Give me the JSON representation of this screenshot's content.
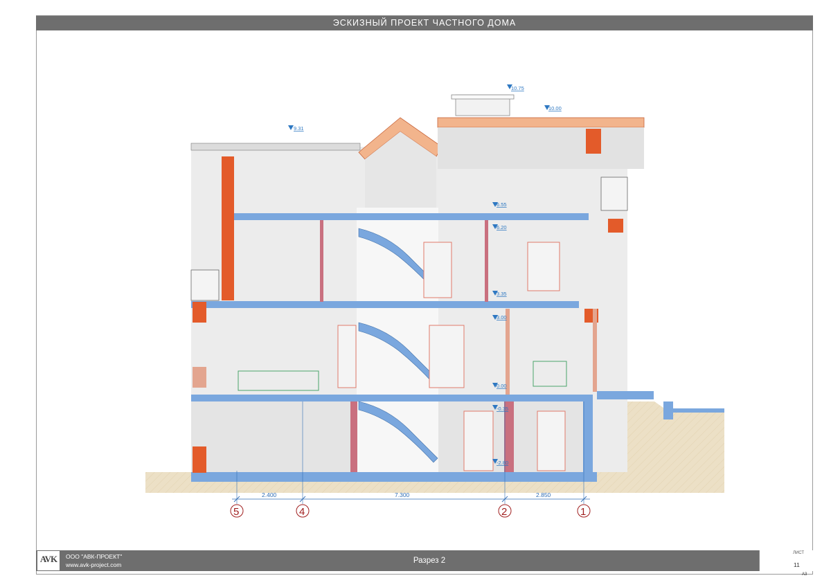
{
  "title": "ЭСКИЗНЫЙ ПРОЕКТ ЧАСТНОГО ДОМА",
  "elevations": [
    "10.75",
    "10.00",
    "9.31",
    "6.55",
    "6.20",
    "3.35",
    "3.00",
    "0.00",
    "-0.35",
    "-2.80"
  ],
  "dimensions": [
    "2.400",
    "7.300",
    "2.850"
  ],
  "axes": [
    "5",
    "4",
    "2",
    "1"
  ],
  "colors": {
    "slab": "#7aa7de",
    "brick": "#e35b2a",
    "soil": "#ece0c6",
    "title_bar": "#6e6e6e"
  },
  "footer": {
    "logo": "AVK",
    "company_name": "ООО \"АВК-ПРОЕКТ\"",
    "website": "www.avk-project.com",
    "sheet_title": "Разрез 2",
    "sheet_label": "ЛИСТ",
    "sheet_number": "11",
    "format": "А3"
  }
}
